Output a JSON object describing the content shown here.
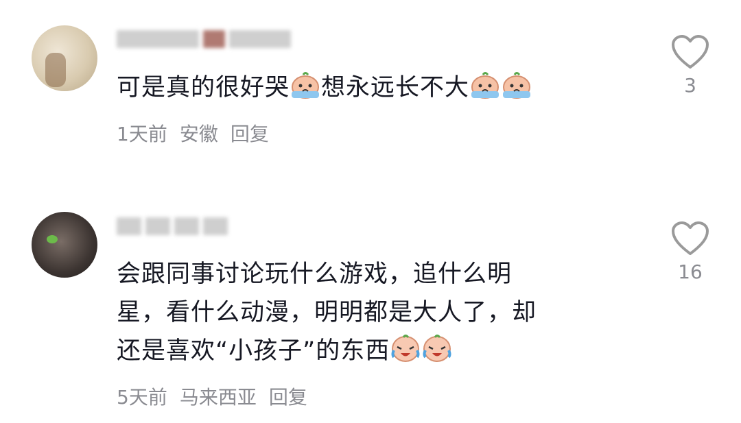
{
  "comments": [
    {
      "text_before_emoji": "可是真的很好哭",
      "text_middle": "想永远长不大",
      "time": "1天前",
      "location": "安徽",
      "reply_label": "回复",
      "like_count": "3",
      "emoji_name": "crying-bun-emoji"
    },
    {
      "lines": [
        "会跟同事讨论玩什么游戏，追什么明",
        "星，看什么动漫，明明都是大人了，却",
        "还是喜欢“小孩子”的东西"
      ],
      "time": "5天前",
      "location": "马来西亚",
      "reply_label": "回复",
      "like_count": "16",
      "emoji_name": "crying-laugh-emoji"
    }
  ],
  "colors": {
    "text": "#161823",
    "secondary": "#8a8b91",
    "heart_outline": "#9a9a9a"
  }
}
